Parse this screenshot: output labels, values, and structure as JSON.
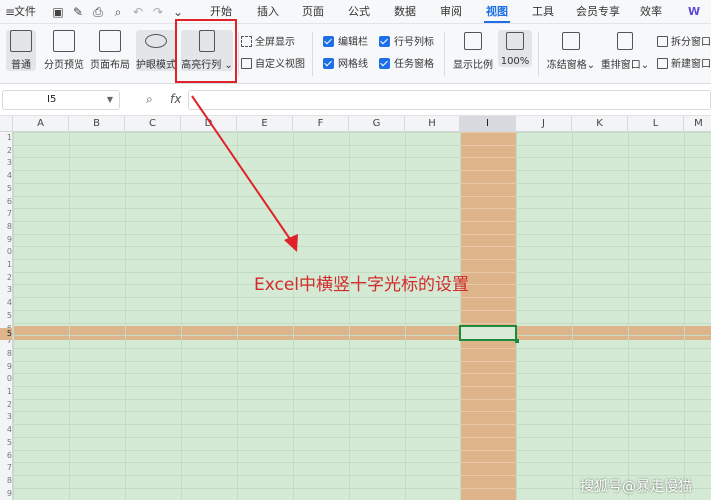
{
  "menubar": {
    "file": "文件",
    "tabs": [
      "开始",
      "插入",
      "页面",
      "公式",
      "数据",
      "审阅",
      "视图",
      "工具",
      "会员专享",
      "效率"
    ],
    "active_tab": "视图",
    "ai_label": "W"
  },
  "ribbon": {
    "normal": "普通",
    "page_break_preview": "分页预览",
    "page_layout": "页面布局",
    "eye_mode": "护眼模式",
    "highlight_row_col": "高亮行列",
    "fullscreen": "全屏显示",
    "custom_view": "自定义视图",
    "formula_bar": "编辑栏",
    "gridlines": "网格线",
    "row_col_headers": "行号列标",
    "task_pane": "任务窗格",
    "zoom": "显示比例",
    "zoom_100": "100%",
    "freeze": "冻结窗格",
    "rearrange": "重排窗口",
    "split": "拆分窗口",
    "new_window": "新建窗口"
  },
  "formula_bar": {
    "cell_ref": "I5",
    "zoom_icon": "magnifier-icon",
    "fx": "fx"
  },
  "grid": {
    "columns": [
      "A",
      "B",
      "C",
      "D",
      "E",
      "F",
      "G",
      "H",
      "I",
      "J",
      "K",
      "L",
      "M"
    ],
    "highlighted_column": "I",
    "row_numbers": [
      "1",
      "2",
      "3",
      "4",
      "5",
      "6",
      "7",
      "8",
      "9",
      "0",
      "1",
      "2",
      "3",
      "4",
      "5",
      "6",
      "7",
      "8",
      "9",
      "0",
      "1",
      "2",
      "3",
      "4",
      "5",
      "6",
      "7",
      "8",
      "9"
    ],
    "active_row_label": "5"
  },
  "annotation": {
    "text": "Excel中横竖十字光标的设置",
    "color": "#d42a2a"
  },
  "watermark": "搜狐号@暴走慢猫",
  "colors": {
    "highlight": "#deb48a",
    "grid_bg": "#d4ead4",
    "accent": "#1c6fe8",
    "redbox": "#e0222b"
  }
}
